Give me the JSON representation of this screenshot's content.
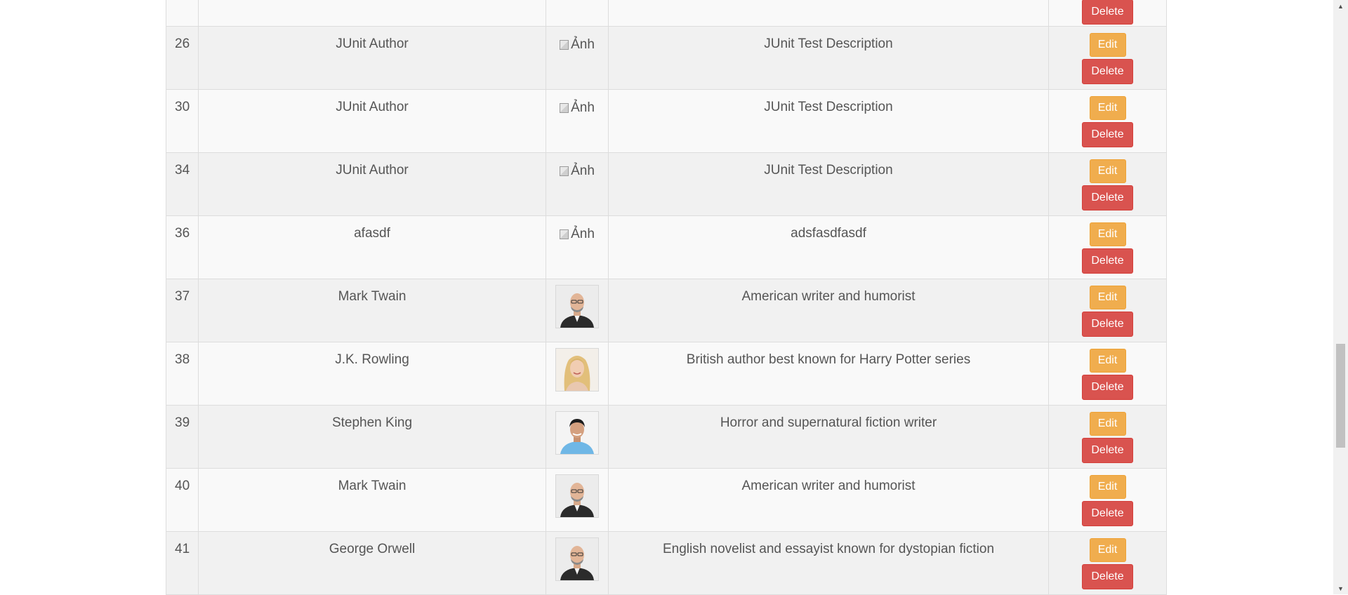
{
  "table": {
    "rows": [
      {
        "id": "",
        "name": "",
        "image_type": "none",
        "description": "",
        "has_edit": false,
        "delete_label": "Delete"
      },
      {
        "id": "26",
        "name": "JUnit Author",
        "image_type": "broken",
        "image_alt": "Ảnh",
        "description": "JUnit Test Description",
        "has_edit": true,
        "edit_label": "Edit",
        "delete_label": "Delete"
      },
      {
        "id": "30",
        "name": "JUnit Author",
        "image_type": "broken",
        "image_alt": "Ảnh",
        "description": "JUnit Test Description",
        "has_edit": true,
        "edit_label": "Edit",
        "delete_label": "Delete"
      },
      {
        "id": "34",
        "name": "JUnit Author",
        "image_type": "broken",
        "image_alt": "Ảnh",
        "description": "JUnit Test Description",
        "has_edit": true,
        "edit_label": "Edit",
        "delete_label": "Delete"
      },
      {
        "id": "36",
        "name": "afasdf",
        "image_type": "broken",
        "image_alt": "Ảnh",
        "description": "adsfasdfasdf",
        "has_edit": true,
        "edit_label": "Edit",
        "delete_label": "Delete"
      },
      {
        "id": "37",
        "name": "Mark Twain",
        "image_type": "photo",
        "avatar": "man-bald-suit",
        "description": "American writer and humorist",
        "has_edit": true,
        "edit_label": "Edit",
        "delete_label": "Delete"
      },
      {
        "id": "38",
        "name": "J.K. Rowling",
        "image_type": "photo",
        "avatar": "woman-blonde",
        "description": "British author best known for Harry Potter series",
        "has_edit": true,
        "edit_label": "Edit",
        "delete_label": "Delete"
      },
      {
        "id": "39",
        "name": "Stephen King",
        "image_type": "photo",
        "avatar": "man-blue-shirt",
        "description": "Horror and supernatural fiction writer",
        "has_edit": true,
        "edit_label": "Edit",
        "delete_label": "Delete"
      },
      {
        "id": "40",
        "name": "Mark Twain",
        "image_type": "photo",
        "avatar": "man-bald-suit",
        "description": "American writer and humorist",
        "has_edit": true,
        "edit_label": "Edit",
        "delete_label": "Delete"
      },
      {
        "id": "41",
        "name": "George Orwell",
        "image_type": "photo",
        "avatar": "man-bald-suit",
        "description": "English novelist and essayist known for dystopian fiction",
        "has_edit": true,
        "edit_label": "Edit",
        "delete_label": "Delete"
      }
    ]
  },
  "colors": {
    "edit_button": "#f0ad4e",
    "delete_button": "#d9534f",
    "row_odd": "#f9f9f9",
    "row_even": "#f1f1f1",
    "border": "#dddddd"
  },
  "scrollbar": {
    "up_icon": "▲",
    "down_icon": "▼"
  }
}
